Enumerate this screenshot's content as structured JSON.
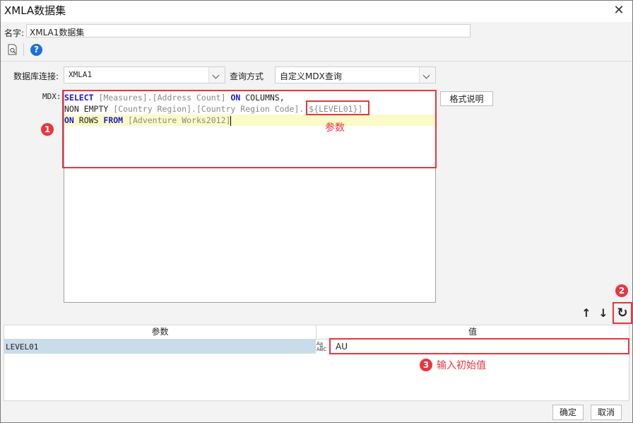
{
  "window": {
    "title": "XMLA数据集",
    "close_glyph": "✕"
  },
  "name_row": {
    "label": "名字:",
    "value": "XMLA1数据集"
  },
  "toolbar": {
    "preview_icon": "preview-icon",
    "help_icon": "help-icon",
    "help_glyph": "?"
  },
  "connection": {
    "label": "数据库连接:",
    "value": "XMLA1"
  },
  "query_mode": {
    "label": "查询方式",
    "value": "自定义MDX查询"
  },
  "mdx": {
    "label": "MDX:",
    "line1": {
      "kw1": "SELECT",
      "b1": "[Measures]",
      "dot1": ".",
      "b2": "[Address Count]",
      "kw2": "ON",
      "rest": " COLUMNS,"
    },
    "line2": {
      "plain": "NON EMPTY ",
      "b1": "[Country Region]",
      "dot1": ".",
      "b2": "[Country Region Code]",
      "dot2": ".",
      "b3": "[${LEVEL01}]"
    },
    "line3": {
      "kw1": "ON",
      "mid": " ROWS ",
      "kw2": "FROM",
      "b1": "[Adventure Works2012]"
    }
  },
  "format_button": {
    "label": "格式说明"
  },
  "annotations": {
    "badge1": "1",
    "badge2": "2",
    "badge3": "3",
    "param_note": "参数",
    "input_note": "输入初始值"
  },
  "param_actions": {
    "up_glyph": "↑",
    "down_glyph": "↓",
    "refresh_glyph": "↻"
  },
  "param_table": {
    "col_param": "参数",
    "col_value": "值",
    "rows": [
      {
        "name": "LEVEL01",
        "type_icon_text": "A̲a\nABC",
        "value": "AU"
      }
    ]
  },
  "footer": {
    "ok": "确定",
    "cancel": "取消"
  },
  "colors": {
    "accent_red": "#e8363d",
    "keyword_blue": "#1a1acc",
    "row_selected": "#c9dcea",
    "help_blue": "#1e6fd9"
  }
}
